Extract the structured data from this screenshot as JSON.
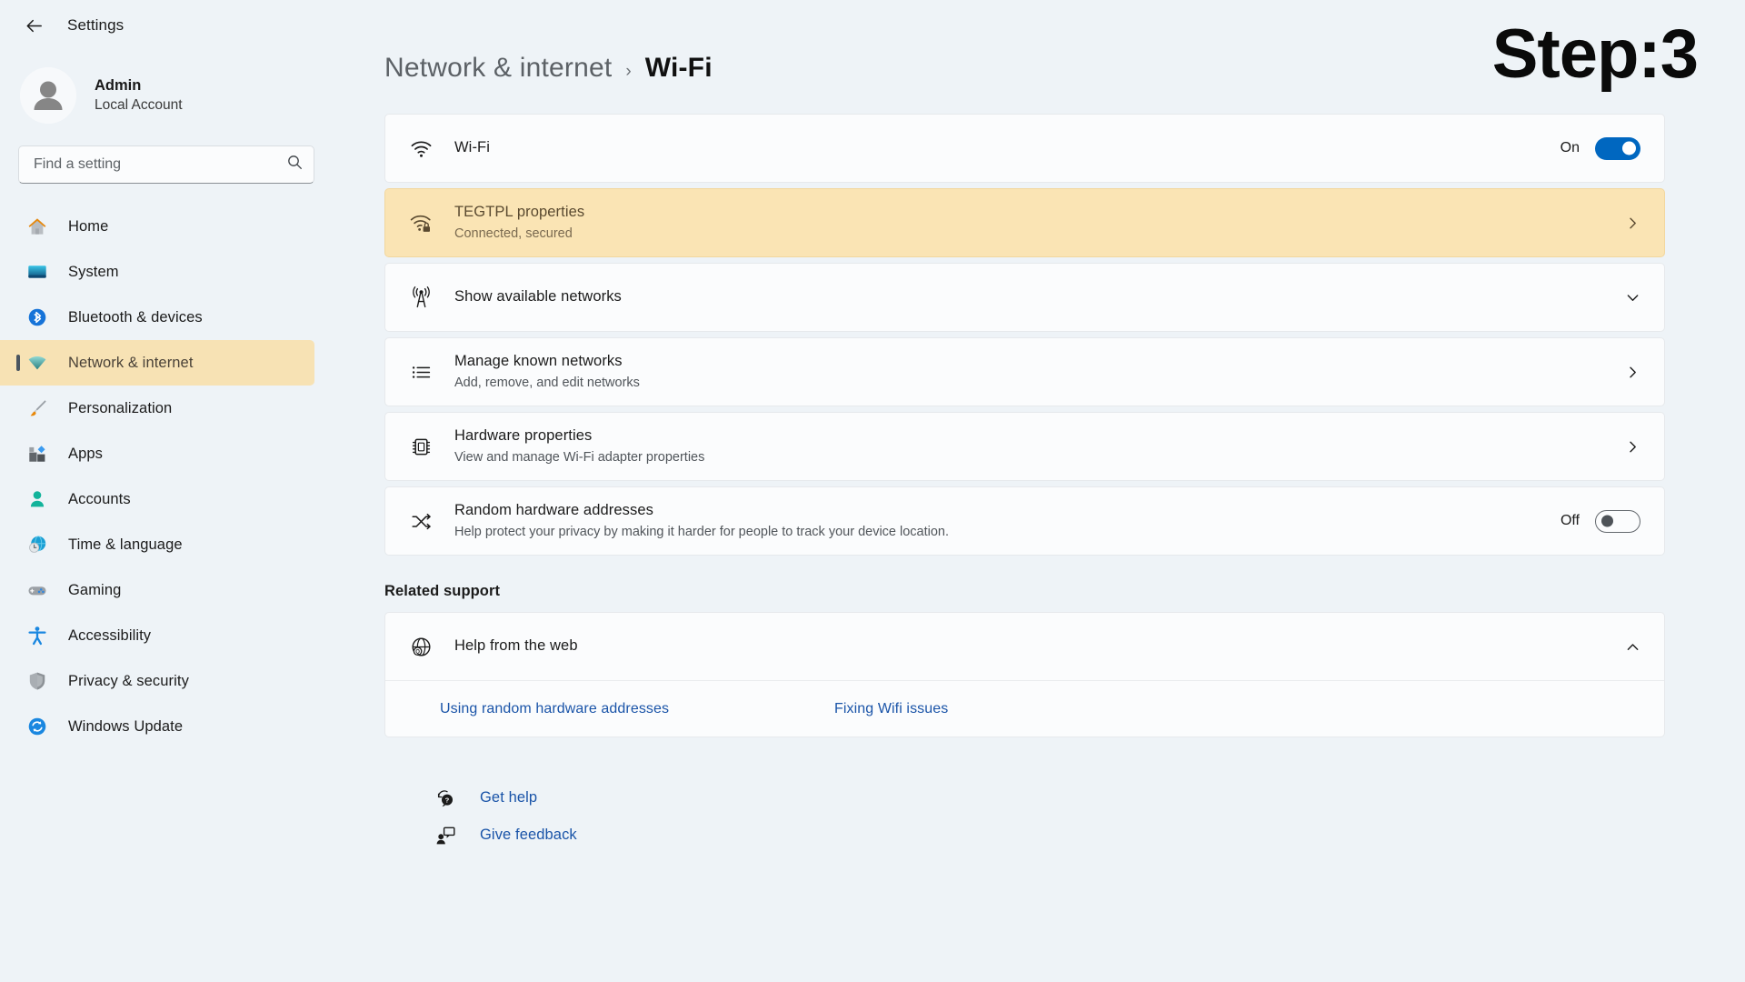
{
  "window": {
    "app_title": "Settings",
    "back_icon": "back-arrow-icon"
  },
  "annotation": {
    "step_label": "Step:3"
  },
  "profile": {
    "name": "Admin",
    "account_type": "Local Account",
    "avatar_icon": "user-avatar-icon"
  },
  "search": {
    "placeholder": "Find a setting",
    "value": "",
    "icon": "search-icon"
  },
  "sidebar": {
    "items": [
      {
        "label": "Home",
        "icon": "home-icon",
        "active": false
      },
      {
        "label": "System",
        "icon": "monitor-icon",
        "active": false
      },
      {
        "label": "Bluetooth & devices",
        "icon": "bluetooth-icon",
        "active": false
      },
      {
        "label": "Network & internet",
        "icon": "wifi-icon",
        "active": true
      },
      {
        "label": "Personalization",
        "icon": "paintbrush-icon",
        "active": false
      },
      {
        "label": "Apps",
        "icon": "apps-icon",
        "active": false
      },
      {
        "label": "Accounts",
        "icon": "person-icon",
        "active": false
      },
      {
        "label": "Time & language",
        "icon": "globe-clock-icon",
        "active": false
      },
      {
        "label": "Gaming",
        "icon": "gamepad-icon",
        "active": false
      },
      {
        "label": "Accessibility",
        "icon": "accessibility-icon",
        "active": false
      },
      {
        "label": "Privacy & security",
        "icon": "shield-icon",
        "active": false
      },
      {
        "label": "Windows Update",
        "icon": "update-icon",
        "active": false
      }
    ]
  },
  "breadcrumb": {
    "parent": "Network & internet",
    "separator": "›",
    "current": "Wi-Fi"
  },
  "settings": {
    "wifi_toggle": {
      "title": "Wi-Fi",
      "icon": "wifi-icon",
      "toggle_state": "On",
      "toggle_on": true
    },
    "network_properties": {
      "title": "TEGTPL properties",
      "subtitle": "Connected, secured",
      "icon": "wifi-lock-icon",
      "chevron": "chevron-right-icon",
      "highlighted": true
    },
    "show_available": {
      "title": "Show available networks",
      "icon": "broadcast-tower-icon",
      "chevron": "chevron-down-icon"
    },
    "manage_known": {
      "title": "Manage known networks",
      "subtitle": "Add, remove, and edit networks",
      "icon": "list-icon",
      "chevron": "chevron-right-icon"
    },
    "hardware_properties": {
      "title": "Hardware properties",
      "subtitle": "View and manage Wi-Fi adapter properties",
      "icon": "chip-icon",
      "chevron": "chevron-right-icon"
    },
    "random_hardware": {
      "title": "Random hardware addresses",
      "subtitle": "Help protect your privacy by making it harder for people to track your device location.",
      "icon": "shuffle-icon",
      "toggle_state": "Off",
      "toggle_on": false
    }
  },
  "related_support": {
    "heading": "Related support",
    "help_from_web": {
      "title": "Help from the web",
      "icon": "globe-help-icon",
      "chevron": "chevron-up-icon"
    },
    "links": [
      "Using random hardware addresses",
      "Fixing Wifi issues"
    ]
  },
  "footer": {
    "get_help": {
      "label": "Get help",
      "icon": "help-bubble-icon"
    },
    "give_feedback": {
      "label": "Give feedback",
      "icon": "feedback-icon"
    }
  },
  "colors": {
    "page_background": "#eef3f7",
    "card_background": "#fbfcfd",
    "highlight_amber": "#fae4b4",
    "toggle_accent": "#0067c0",
    "link_blue": "#1a54a8"
  }
}
